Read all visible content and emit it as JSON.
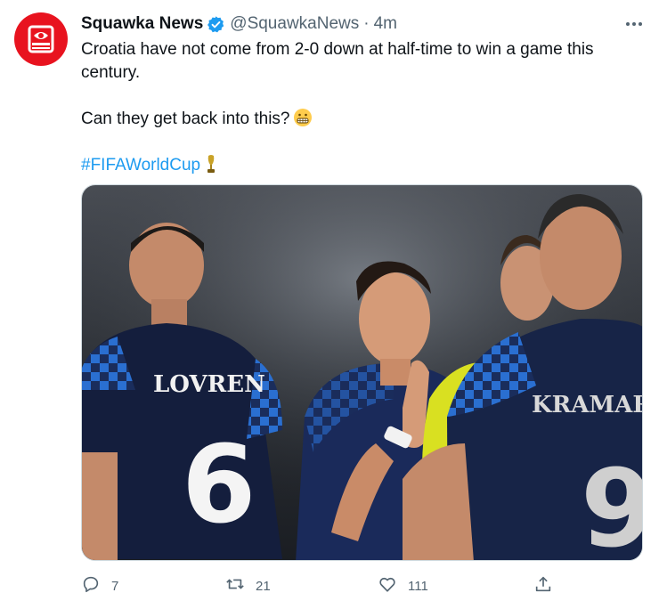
{
  "tweet": {
    "author_name": "Squawka News",
    "author_handle": "@SquawkaNews",
    "separator": "·",
    "time": "4m",
    "text_line1": "Croatia have not come from 2-0 down at half-time to win a game this century.",
    "text_line2": "Can they get back into this?",
    "hashtag": "#FIFAWorldCup",
    "jersey_name_left": "LOVREN",
    "jersey_number_left": "6",
    "jersey_name_right": "KRAMARIĆ",
    "jersey_number_right": "9"
  },
  "actions": {
    "reply_count": "7",
    "retweet_count": "21",
    "like_count": "111"
  },
  "icons": {
    "avatar": "squawka-logo-icon",
    "verified": "verified-badge-icon",
    "more": "more-icon",
    "emoji": "grimacing-face-emoji-icon",
    "trophy": "trophy-emoji-icon",
    "reply": "reply-icon",
    "retweet": "retweet-icon",
    "like": "like-icon",
    "share": "share-icon"
  },
  "colors": {
    "brand_red": "#e8131f",
    "link_blue": "#1d9bf0",
    "muted_gray": "#536471",
    "text_dark": "#0f1419"
  }
}
